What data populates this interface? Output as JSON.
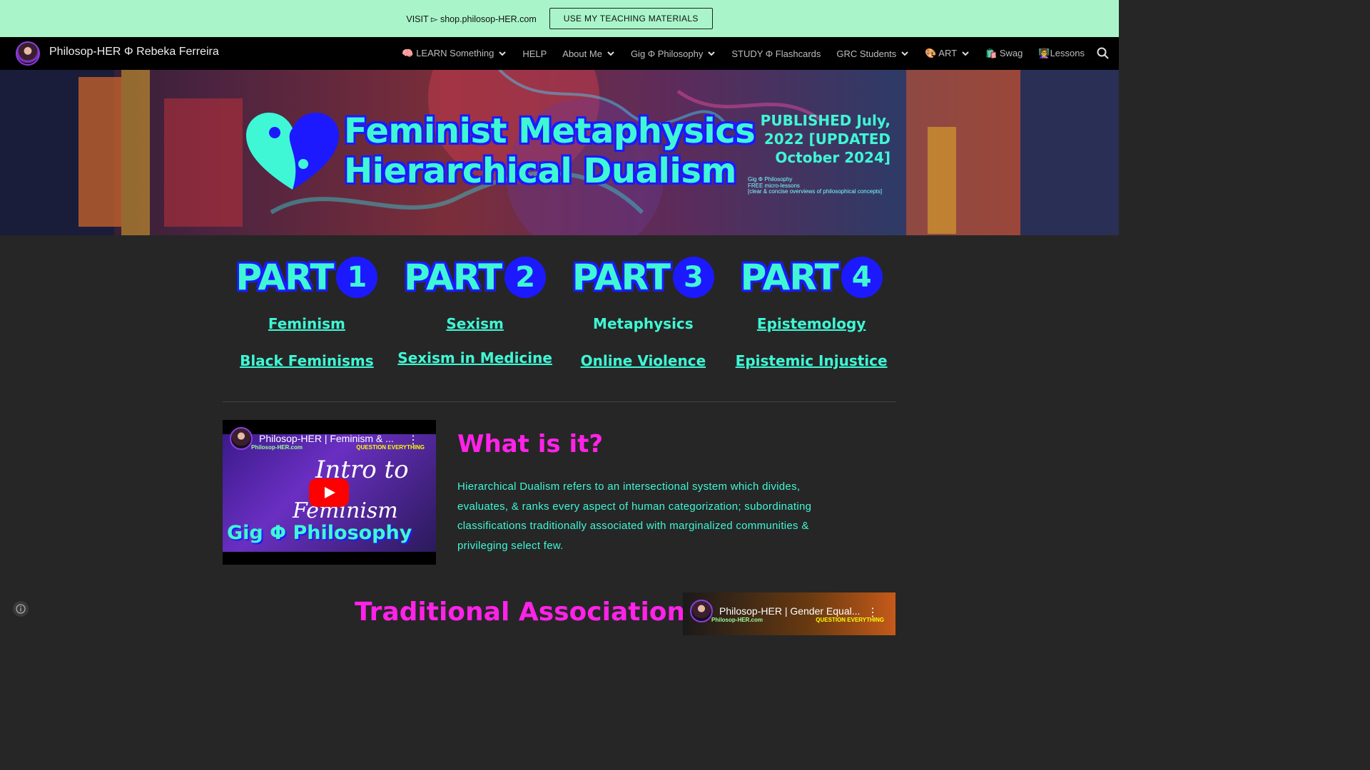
{
  "announcement": {
    "text": "VISIT ▻ shop.philosop-HER.com",
    "button_label": "USE MY TEACHING MATERIALS"
  },
  "nav": {
    "site_title": "Philosop-HER Φ Rebeka Ferreira",
    "items": [
      {
        "label": "🧠 LEARN Something",
        "has_dropdown": true
      },
      {
        "label": "HELP",
        "has_dropdown": false
      },
      {
        "label": "About Me",
        "has_dropdown": true
      },
      {
        "label": "Gig Φ Philosophy",
        "has_dropdown": true
      },
      {
        "label": "STUDY Φ Flashcards",
        "has_dropdown": false
      },
      {
        "label": "GRC Students",
        "has_dropdown": true
      },
      {
        "label": "🎨 ART",
        "has_dropdown": true
      },
      {
        "label": "🛍️ Swag",
        "has_dropdown": false
      },
      {
        "label": "👩‍🏫Lessons",
        "has_dropdown": false
      }
    ],
    "search_icon": "search-icon"
  },
  "banner": {
    "title_line1": "Feminist Metaphysics",
    "title_line2": "Hierarchical Dualism",
    "published_line1": "PUBLISHED July,",
    "published_line2": "2022 [UPDATED",
    "published_line3": "October 2024]",
    "small_line1": "Gig Φ Philosophy",
    "small_line2": "FREE micro-lessons",
    "small_line3": "[clear & concise overviews of philosophical concepts]"
  },
  "parts": [
    {
      "word": "PART",
      "num": "1",
      "topic1": "Feminism",
      "topic2": "Black Feminisms",
      "topic1_link": true
    },
    {
      "word": "PART",
      "num": "2",
      "topic1": "Sexism",
      "topic2": "Sexism in Medicine",
      "topic1_link": true
    },
    {
      "word": "PART",
      "num": "3",
      "topic1": "Metaphysics",
      "topic2": "Online Violence",
      "topic1_link": false
    },
    {
      "word": "PART",
      "num": "4",
      "topic1": "Epistemology",
      "topic2": "Epistemic Injustice",
      "topic1_link": true
    }
  ],
  "video1": {
    "title": "Philosop-HER | Feminism & ...",
    "channel_tag": "Philosop-HER.com",
    "tagline": "QUESTION EVERYTHING",
    "thumb_line1": "Intro to",
    "thumb_line2": "Feminism",
    "thumb_line3": "Gig Φ Philosophy"
  },
  "section": {
    "heading": "What is it?",
    "description": "Hierarchical Dualism refers to an intersectional system which divides, evaluates, & ranks every aspect of human categorization; subordinating classifications traditionally associated with marginalized communities & privileging select few.",
    "next_heading": "Traditional Associations"
  },
  "video2": {
    "title": "Philosop-HER | Gender Equal...",
    "channel_tag": "Philosop-HER.com",
    "tagline": "QUESTION EVERYTHING"
  },
  "colors": {
    "accent_cyan": "#3ff7d5",
    "accent_blue": "#1d19ff",
    "accent_magenta": "#ff22e8",
    "announce_bg": "#a9f5c9"
  }
}
